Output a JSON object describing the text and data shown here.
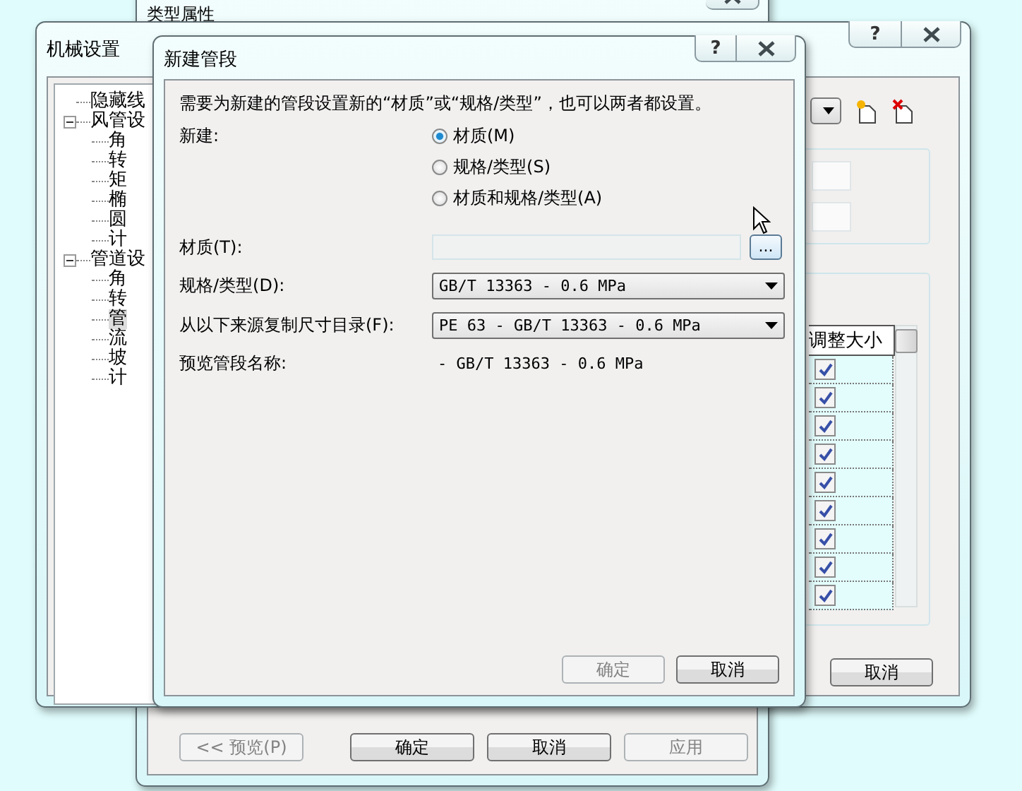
{
  "type_properties": {
    "title": "类型属性",
    "buttons": [
      {
        "label": "<< 预览(P)",
        "disabled": true
      },
      {
        "label": "确定",
        "disabled": false
      },
      {
        "label": "取消",
        "disabled": false
      },
      {
        "label": "应用",
        "disabled": true
      }
    ]
  },
  "mechanical_settings": {
    "title": "机械设置",
    "help_button": "?",
    "tree": [
      {
        "label": "隐藏线"
      },
      {
        "label": "风管设",
        "expanded": true,
        "children": [
          {
            "label": "角"
          },
          {
            "label": "转"
          },
          {
            "label": "矩"
          },
          {
            "label": "椭"
          },
          {
            "label": "圆"
          },
          {
            "label": "计"
          }
        ]
      },
      {
        "label": "管道设",
        "expanded": true,
        "children": [
          {
            "label": "角"
          },
          {
            "label": "转"
          },
          {
            "label": "管",
            "selected": true
          },
          {
            "label": "流"
          },
          {
            "label": "坡"
          },
          {
            "label": "计"
          }
        ]
      }
    ],
    "table": {
      "columns": [
        "调整大小"
      ],
      "rows": [
        {
          "checked": true
        },
        {
          "checked": true
        },
        {
          "checked": true
        },
        {
          "checked": true
        },
        {
          "checked": true
        },
        {
          "checked": true
        },
        {
          "checked": true
        },
        {
          "checked": true
        },
        {
          "checked": true
        }
      ]
    },
    "buttons": [
      {
        "label": "取消"
      }
    ]
  },
  "new_segment": {
    "title": "新建管段",
    "help_button": "?",
    "instruction": "需要为新建的管段设置新的“材质”或“规格/类型”，也可以两者都设置。",
    "new_label": "新建:",
    "options": [
      {
        "label": "材质(M)",
        "selected": true
      },
      {
        "label": "规格/类型(S)",
        "selected": false
      },
      {
        "label": "材质和规格/类型(A)",
        "selected": false
      }
    ],
    "material": {
      "label": "材质(T):",
      "disabled": true,
      "browse_button": "..."
    },
    "spec": {
      "label": "规格/类型(D):",
      "value": "GB/T 13363 - 0.6 MPa"
    },
    "copy_from": {
      "label": "从以下来源复制尺寸目录(F):",
      "value": "PE 63 - GB/T 13363 - 0.6 MPa"
    },
    "preview": {
      "label": "预览管段名称:",
      "value": "- GB/T 13363 - 0.6 MPa"
    },
    "buttons": [
      {
        "label": "确定",
        "disabled": true
      },
      {
        "label": "取消",
        "disabled": false
      }
    ]
  }
}
